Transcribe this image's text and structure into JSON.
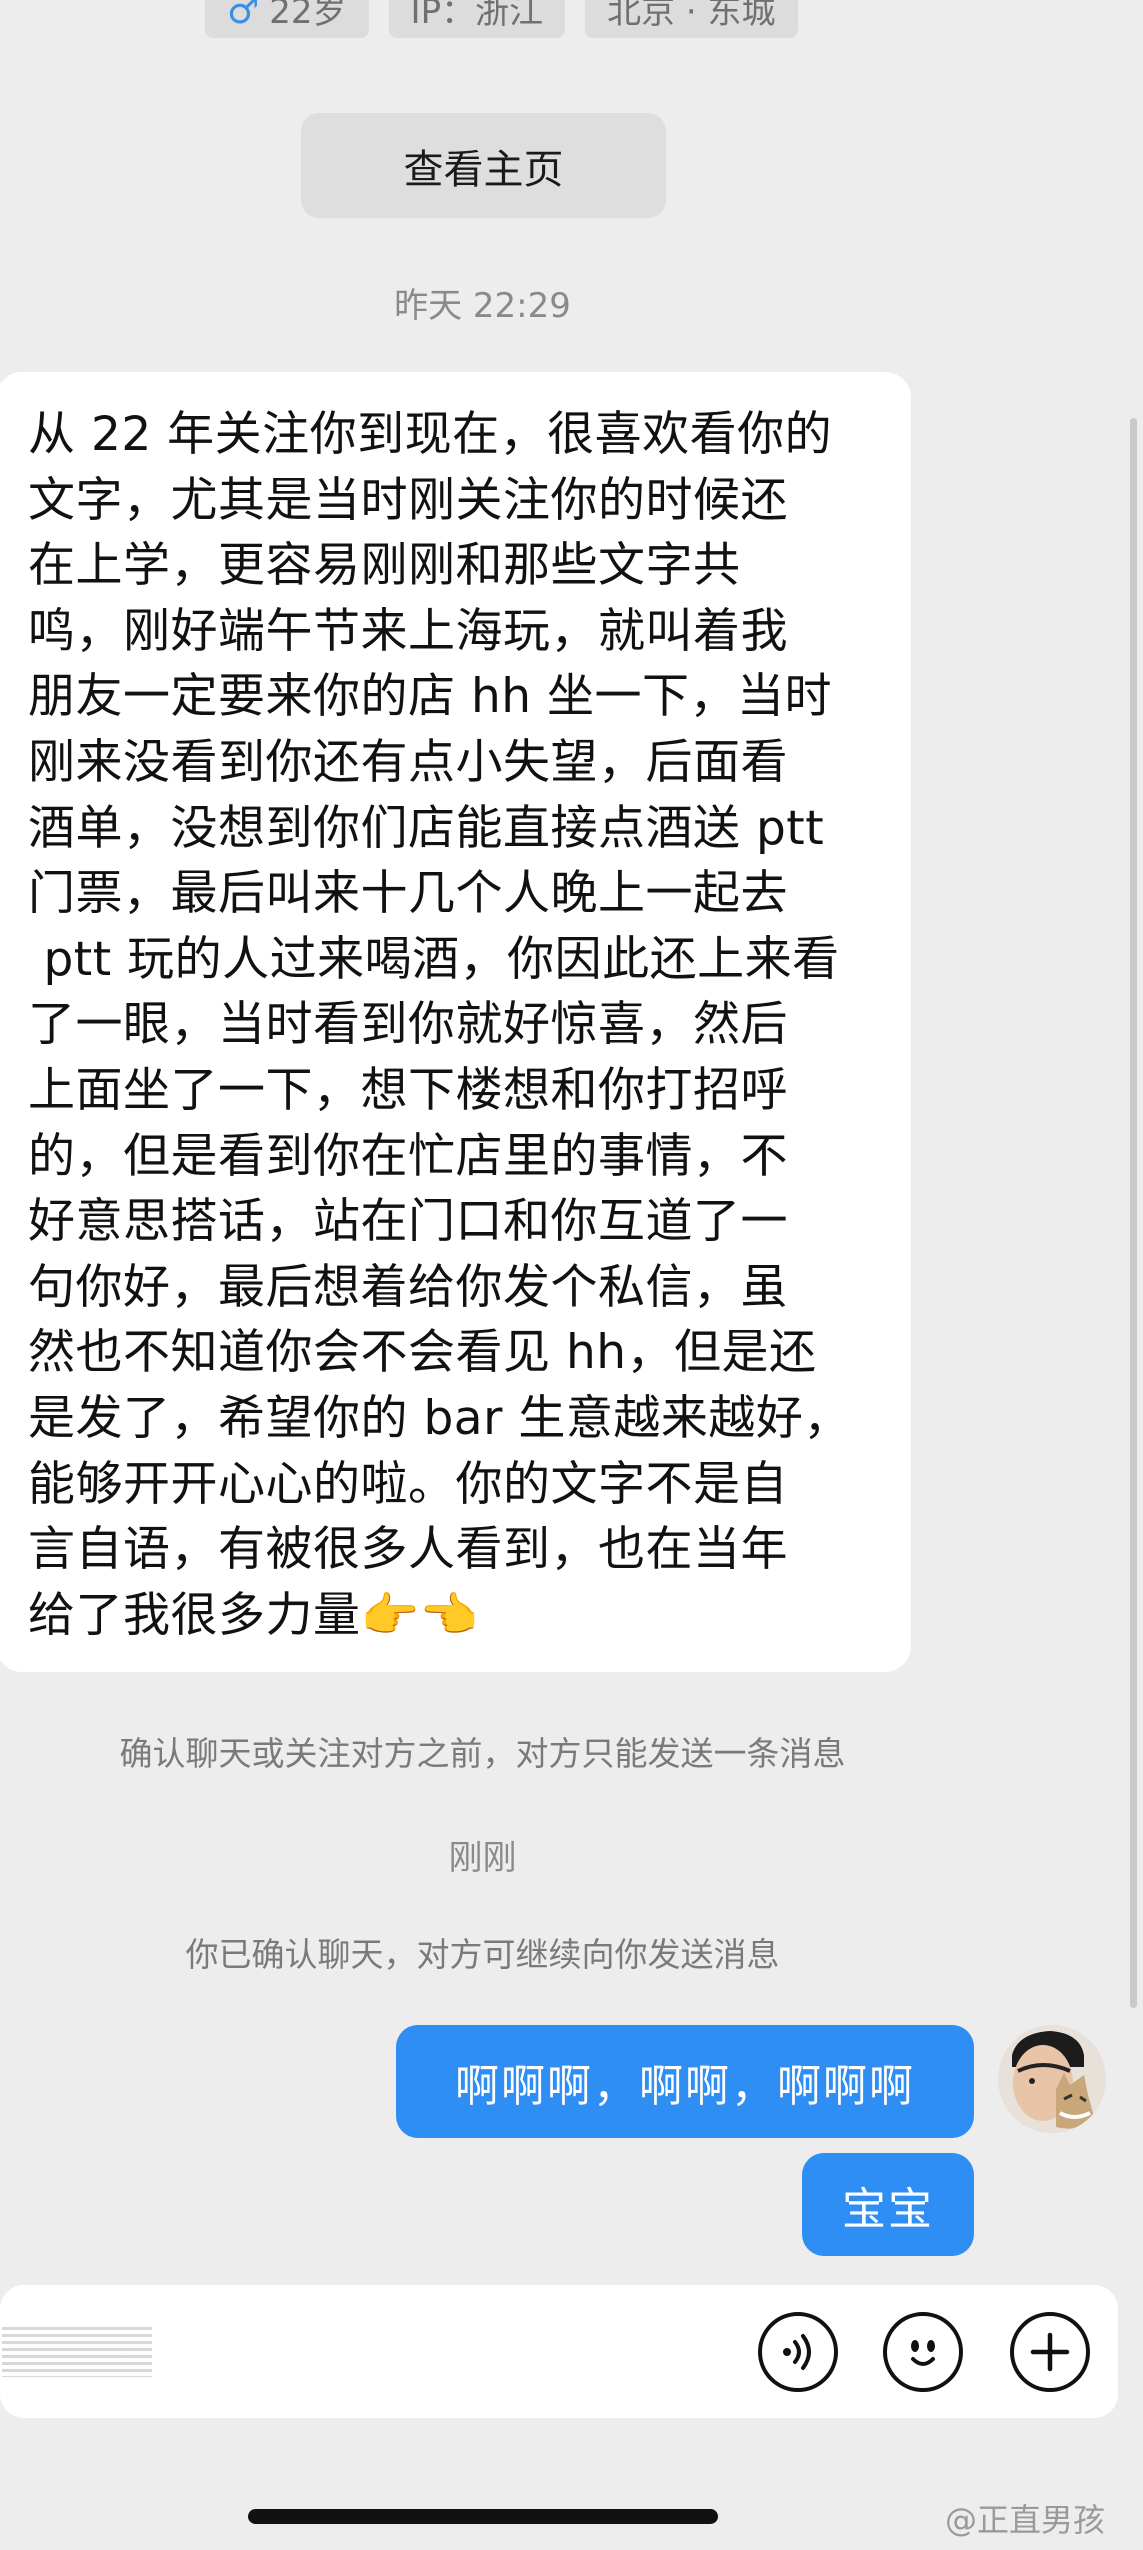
{
  "profile_tags": {
    "gender_symbol": "♂",
    "age": "22岁",
    "ip": "IP：浙江",
    "location": "北京 · 东城"
  },
  "view_home_button": "查看主页",
  "timestamp_yesterday": "昨天 22:29",
  "incoming_message": "从 22 年关注你到现在，很喜欢看你的\n文字，尤其是当时刚关注你的时候还\n在上学，更容易刚刚和那些文字共\n鸣，刚好端午节来上海玩，就叫着我\n朋友一定要来你的店 hh 坐一下，当时\n刚来没看到你还有点小失望，后面看\n酒单，没想到你们店能直接点酒送 ptt\n门票，最后叫来十几个人晚上一起去\n ptt 玩的人过来喝酒，你因此还上来看\n了一眼，当时看到你就好惊喜，然后\n上面坐了一下，想下楼想和你打招呼\n的，但是看到你在忙店里的事情，不\n好意思搭话，站在门口和你互道了一\n句你好，最后想着给你发个私信，虽\n然也不知道你会不会看见 hh，但是还\n是发了，希望你的 bar 生意越来越好，\n能够开开心心的啦。你的文字不是自\n言自语，有被很多人看到，也在当年\n给了我很多力量👉👈",
  "notice_limit": "确认聊天或关注对方之前，对方只能发送一条消息",
  "timestamp_now": "刚刚",
  "notice_confirmed": "你已确认聊天，对方可继续向你发送消息",
  "outgoing_messages": [
    "啊啊啊，啊啊，啊啊啊",
    "宝宝"
  ],
  "input_icons": [
    "voice-icon",
    "emoji-icon",
    "plus-icon"
  ],
  "watermark": "@正直男孩",
  "colors": {
    "accent": "#2f8ef3",
    "background": "#ededed",
    "bubble_in": "#ffffff"
  }
}
